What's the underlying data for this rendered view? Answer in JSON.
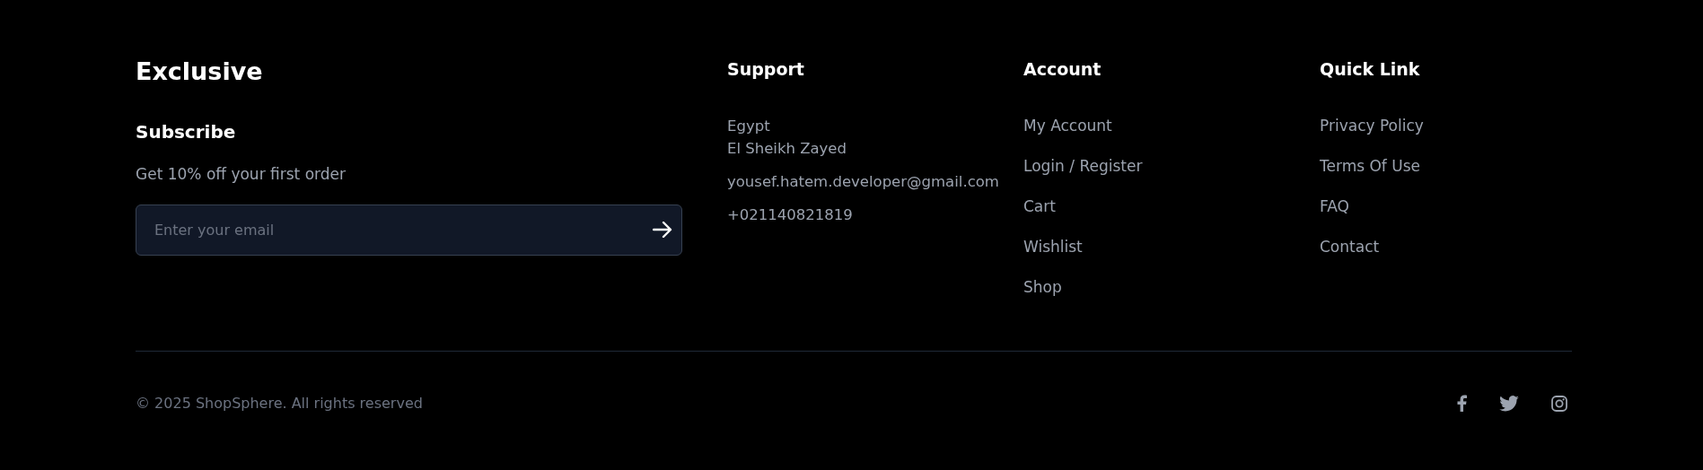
{
  "brand": {
    "title": "Exclusive",
    "subtitle": "Subscribe",
    "offer": "Get 10% off your first order",
    "email_field": {
      "placeholder": "Enter your email"
    }
  },
  "columns": [
    {
      "heading": "Support",
      "kind": "contact",
      "items": [
        {
          "lines": [
            "Egypt",
            "El Sheikh Zayed"
          ]
        },
        {
          "lines": [
            "yousef.hatem.developer@gmail.com"
          ]
        },
        {
          "lines": [
            "+021140821819"
          ]
        }
      ]
    },
    {
      "heading": "Account",
      "kind": "links",
      "items": [
        {
          "lines": [
            "My Account"
          ]
        },
        {
          "lines": [
            "Login / Register"
          ]
        },
        {
          "lines": [
            "Cart"
          ]
        },
        {
          "lines": [
            "Wishlist"
          ]
        },
        {
          "lines": [
            "Shop"
          ]
        }
      ]
    },
    {
      "heading": "Quick Link",
      "kind": "links",
      "items": [
        {
          "lines": [
            "Privacy Policy"
          ]
        },
        {
          "lines": [
            "Terms Of Use"
          ]
        },
        {
          "lines": [
            "FAQ"
          ]
        },
        {
          "lines": [
            "Contact"
          ]
        }
      ]
    }
  ],
  "copyright": "© 2025 ShopSphere. All rights reserved",
  "social": [
    {
      "kind": "facebook"
    },
    {
      "kind": "twitter"
    },
    {
      "kind": "instagram"
    }
  ]
}
